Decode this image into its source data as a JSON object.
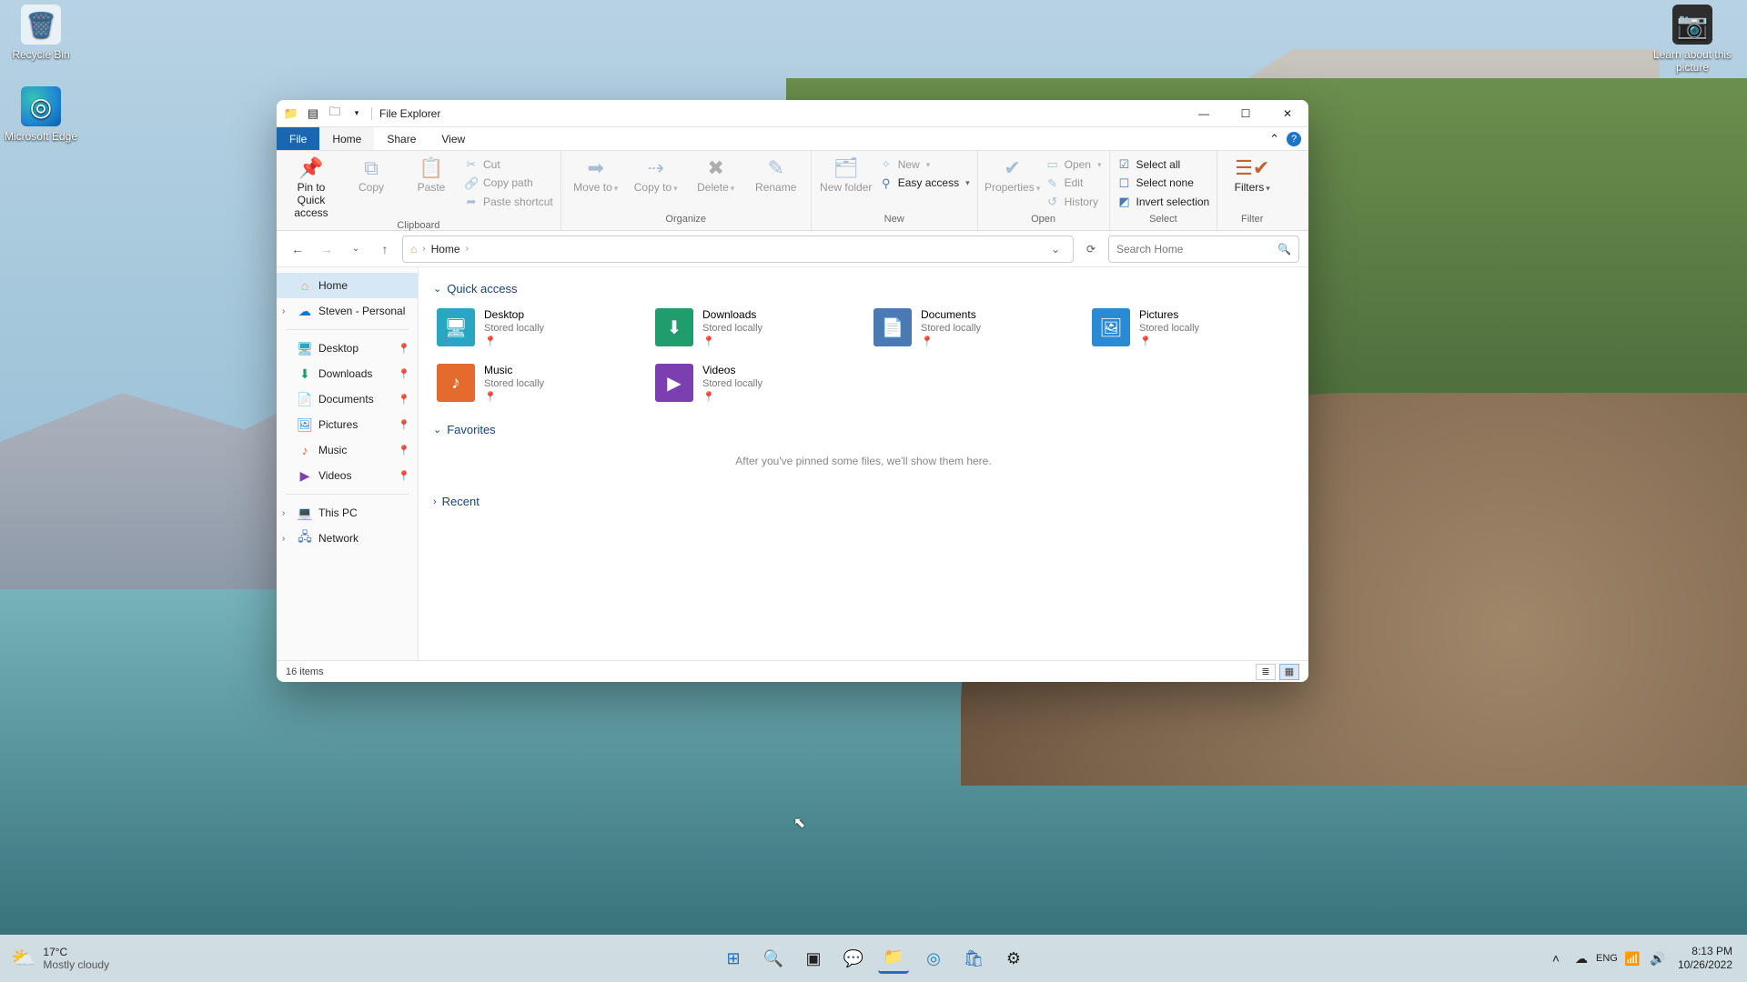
{
  "desktop_icons": {
    "recycle": "Recycle Bin",
    "edge": "Microsoft Edge",
    "learn": "Learn about this picture"
  },
  "window": {
    "title": "File Explorer",
    "tabs": {
      "file": "File",
      "home": "Home",
      "share": "Share",
      "view": "View"
    }
  },
  "ribbon": {
    "clipboard": {
      "label": "Clipboard",
      "pin": "Pin to Quick access",
      "copy": "Copy",
      "paste": "Paste",
      "cut": "Cut",
      "copypath": "Copy path",
      "pasteshort": "Paste shortcut"
    },
    "organize": {
      "label": "Organize",
      "moveto": "Move to",
      "copyto": "Copy to",
      "delete": "Delete",
      "rename": "Rename"
    },
    "new_": {
      "label": "New",
      "newfolder": "New folder",
      "newitem": "New",
      "easy": "Easy access"
    },
    "open": {
      "label": "Open",
      "properties": "Properties",
      "open": "Open",
      "edit": "Edit",
      "history": "History"
    },
    "select": {
      "label": "Select",
      "all": "Select all",
      "none": "Select none",
      "invert": "Invert selection"
    },
    "filter": {
      "label": "Filter",
      "filters": "Filters"
    }
  },
  "nav": {
    "breadcrumb_root": "Home",
    "search_placeholder": "Search Home"
  },
  "sidebar": {
    "home": "Home",
    "onedrive": "Steven - Personal",
    "desktop": "Desktop",
    "downloads": "Downloads",
    "documents": "Documents",
    "pictures": "Pictures",
    "music": "Music",
    "videos": "Videos",
    "thispc": "This PC",
    "network": "Network"
  },
  "groups": {
    "quick": "Quick access",
    "favorites": "Favorites",
    "recent": "Recent",
    "fav_empty": "After you've pinned some files, we'll show them here."
  },
  "quick_items": [
    {
      "name": "Desktop",
      "sub": "Stored locally",
      "color": "#2aa7c0"
    },
    {
      "name": "Downloads",
      "sub": "Stored locally",
      "color": "#1f9d6d"
    },
    {
      "name": "Documents",
      "sub": "Stored locally",
      "color": "#4b79b2"
    },
    {
      "name": "Pictures",
      "sub": "Stored locally",
      "color": "#2a8ad4"
    },
    {
      "name": "Music",
      "sub": "Stored locally",
      "color": "#e46a2e"
    },
    {
      "name": "Videos",
      "sub": "Stored locally",
      "color": "#7b3fb0"
    }
  ],
  "status": {
    "items": "16 items"
  },
  "taskbar": {
    "temp": "17°C",
    "cond": "Mostly cloudy",
    "time": "8:13 PM",
    "date": "10/26/2022"
  }
}
